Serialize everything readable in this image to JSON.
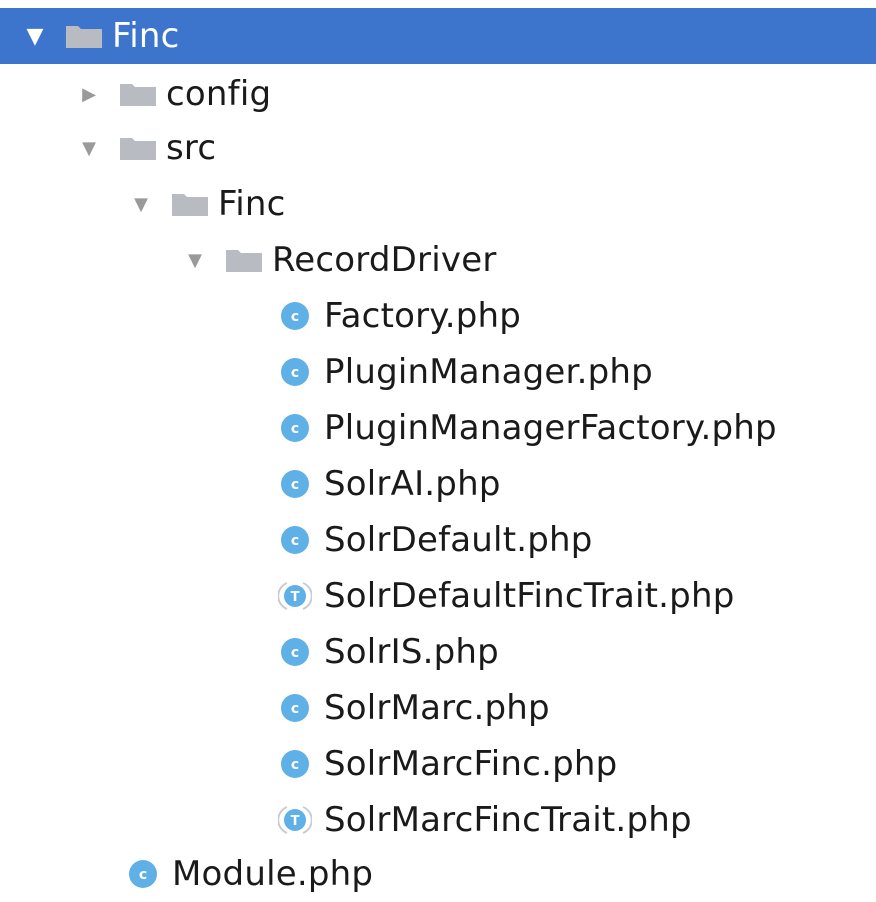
{
  "colors": {
    "selection": "#3d74cc",
    "class_icon": "#5fb0e6",
    "trait_icon": "#5fb0e6",
    "folder": "#b8bcc2",
    "arrow": "#9a9a9a"
  },
  "tree": {
    "root": {
      "label": "Finc",
      "expanded": true,
      "selected": true,
      "icon": "folder-icon"
    },
    "config": {
      "label": "config",
      "expanded": false,
      "icon": "folder-icon"
    },
    "src": {
      "label": "src",
      "expanded": true,
      "icon": "folder-icon"
    },
    "src_finc": {
      "label": "Finc",
      "expanded": true,
      "icon": "folder-icon"
    },
    "record_driver": {
      "label": "RecordDriver",
      "expanded": true,
      "icon": "folder-icon"
    },
    "files": [
      {
        "label": "Factory.php",
        "icon": "class-icon",
        "glyph": "c"
      },
      {
        "label": "PluginManager.php",
        "icon": "class-icon",
        "glyph": "c"
      },
      {
        "label": "PluginManagerFactory.php",
        "icon": "class-icon",
        "glyph": "c"
      },
      {
        "label": "SolrAI.php",
        "icon": "class-icon",
        "glyph": "c"
      },
      {
        "label": "SolrDefault.php",
        "icon": "class-icon",
        "glyph": "c"
      },
      {
        "label": "SolrDefaultFincTrait.php",
        "icon": "trait-icon",
        "glyph": "T"
      },
      {
        "label": "SolrIS.php",
        "icon": "class-icon",
        "glyph": "c"
      },
      {
        "label": "SolrMarc.php",
        "icon": "class-icon",
        "glyph": "c"
      },
      {
        "label": "SolrMarcFinc.php",
        "icon": "class-icon",
        "glyph": "c"
      },
      {
        "label": "SolrMarcFincTrait.php",
        "icon": "trait-icon",
        "glyph": "T"
      }
    ],
    "module": {
      "label": "Module.php",
      "icon": "class-icon",
      "glyph": "c"
    }
  }
}
